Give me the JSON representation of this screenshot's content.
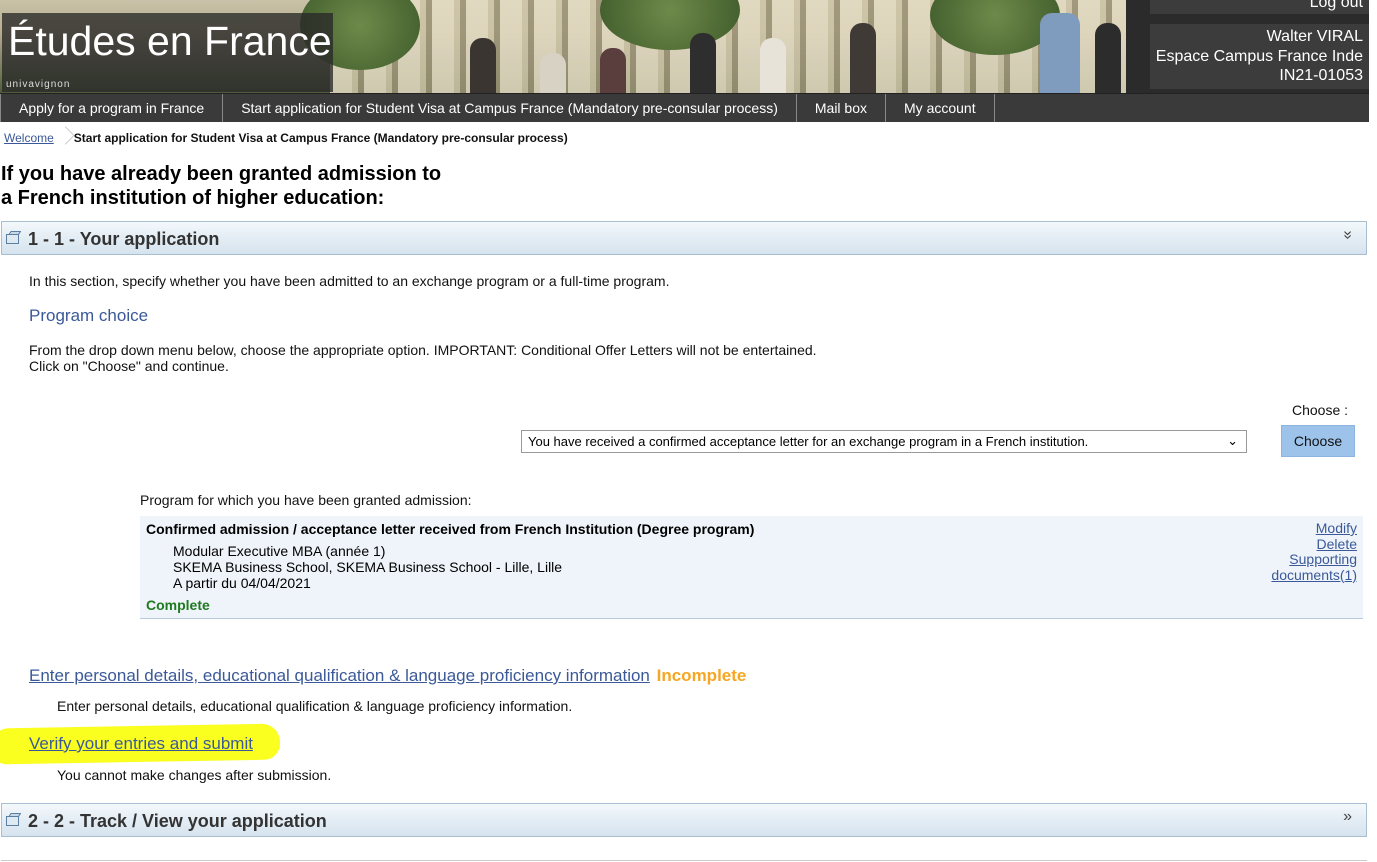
{
  "header": {
    "site_title": "Études en France",
    "logo_subtext": "univavignon",
    "logout_label": "Log out",
    "user_name": "Walter VIRAL",
    "user_office": "Espace Campus France Inde",
    "user_id": "IN21-01053"
  },
  "nav": {
    "items": [
      {
        "label": "Apply for a program in France"
      },
      {
        "label": "Start application for Student Visa at Campus France (Mandatory pre-consular process)"
      },
      {
        "label": "Mail box"
      },
      {
        "label": "My account"
      }
    ]
  },
  "breadcrumb": {
    "home": "Welcome",
    "current": "Start application for Student Visa at Campus France (Mandatory pre-consular process)"
  },
  "page": {
    "title_line1": "If you have already been granted admission to",
    "title_line2": "a French institution of higher education:"
  },
  "section1": {
    "title": "1 - 1 - Your application",
    "toggle": "»",
    "intro": "In this section, specify whether you have been admitted to an exchange program or a full-time program.",
    "program_choice_heading": "Program choice",
    "instruction_line1": "From the drop down menu below, choose the appropriate option. IMPORTANT: Conditional Offer Letters will not be entertained.",
    "instruction_line2": "Click on \"Choose\" and continue.",
    "choose_label": "Choose :",
    "select_value": "You have received a confirmed acceptance letter for an exchange program in a French institution.",
    "choose_button": "Choose",
    "admission_label": "Program for which you have been granted admission:",
    "program": {
      "title": "Confirmed admission / acceptance letter received from French Institution (Degree program)",
      "line1": "Modular Executive MBA (année 1)",
      "line2": "SKEMA Business School, SKEMA Business School - Lille, Lille",
      "line3": "A partir du 04/04/2021",
      "status": "Complete",
      "modify": "Modify",
      "delete": "Delete",
      "supporting": "Supporting",
      "documents": "documents(1)"
    },
    "personal_link": "Enter personal details, educational qualification & language proficiency information",
    "personal_status": "Incomplete",
    "personal_desc": "Enter personal details, educational qualification & language proficiency information.",
    "verify_link": "Verify your entries and submit",
    "verify_desc": "You cannot make changes after submission."
  },
  "section2": {
    "title": "2 - 2 - Track / View your application",
    "toggle": "»"
  },
  "colors": {
    "link": "#3b5998",
    "complete": "#1f7a1f",
    "incomplete": "#f5a623",
    "highlight": "#fbff20",
    "nav_bg": "#3a3a3a",
    "button_bg": "#9dc3ea"
  }
}
